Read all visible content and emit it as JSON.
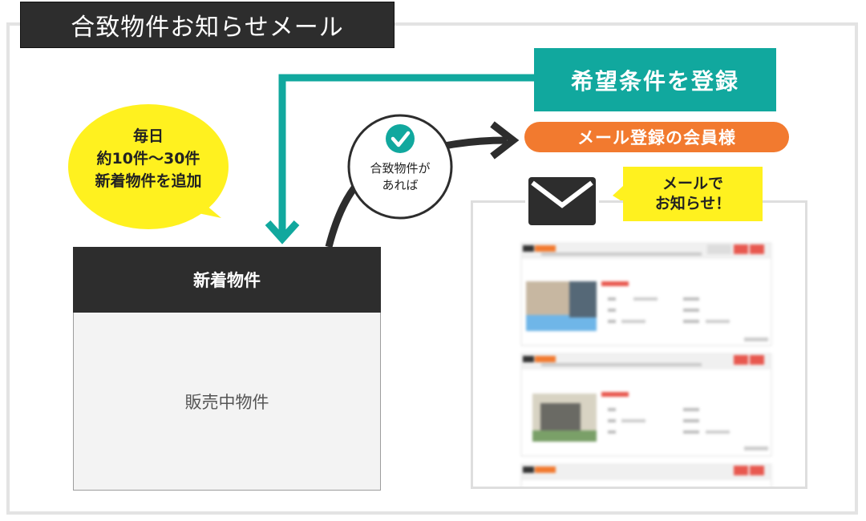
{
  "header": {
    "title": "合致物件お知らせメール"
  },
  "steps": {
    "register": "希望条件を登録",
    "member": "メール登録の会員様"
  },
  "bubble": {
    "line1": "毎日",
    "line2": "約10件〜30件",
    "line3": "新着物件を追加"
  },
  "match": {
    "line1": "合致物件が",
    "line2": "あれば"
  },
  "notify": {
    "line1": "メールで",
    "line2": "お知らせ！"
  },
  "listing": {
    "new_label": "新着物件",
    "sale_label": "販売中物件"
  },
  "colors": {
    "teal": "#11a89e",
    "orange": "#f27a2f",
    "yellow": "#fff11f",
    "dark": "#2d2d2d",
    "accent_red": "#e8584f"
  },
  "icons": [
    "checkmark-icon",
    "envelope-icon",
    "arrow-icon"
  ]
}
